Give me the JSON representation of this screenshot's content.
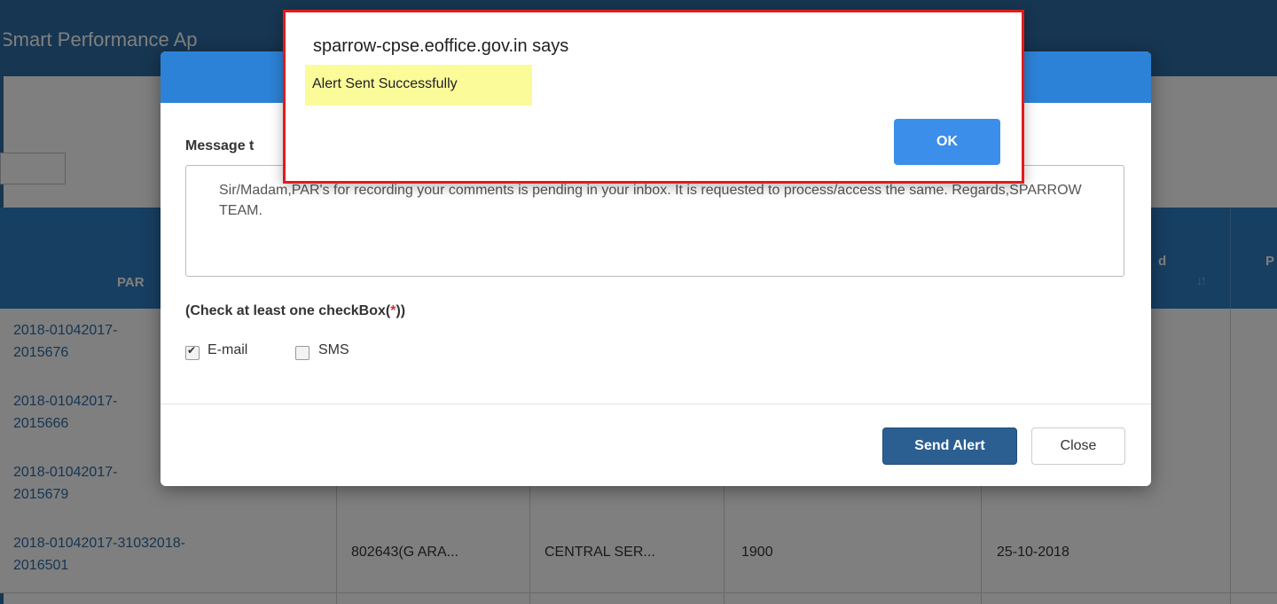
{
  "app": {
    "title": "Smart Performance Ap"
  },
  "table": {
    "headers": {
      "col1_partial": "PAR",
      "col_d_partial": "d",
      "col_p_partial": "P"
    },
    "rows": [
      {
        "par_no": "2018-01042017-\n2015676",
        "employee": "",
        "service": "",
        "batch": "",
        "date": ""
      },
      {
        "par_no": "2018-01042017-\n2015666",
        "employee": "",
        "service": "",
        "batch": "",
        "date": ""
      },
      {
        "par_no": "2018-01042017-\n2015679",
        "employee": "",
        "service": "",
        "batch": "",
        "date": ""
      },
      {
        "par_no": "2018-01042017-31032018-\n2016501",
        "employee": "802643(G ARA...",
        "service": "CENTRAL SER...",
        "batch": "1900",
        "date": "25-10-2018"
      }
    ]
  },
  "modal": {
    "message_label": "Message t",
    "message_text": "Sir/Madam,PAR's for recording your comments is pending in your inbox. It is requested to process/access the same. Regards,SPARROW TEAM.",
    "check_note_prefix": "(Check at least one checkBox(",
    "check_note_star": "*",
    "check_note_suffix": "))",
    "email_label": "E-mail",
    "email_checked": true,
    "sms_label": "SMS",
    "sms_checked": false,
    "send_label": "Send Alert",
    "close_label": "Close"
  },
  "alert": {
    "origin": "sparrow-cpse.eoffice.gov.in says",
    "message": "Alert Sent Successfully",
    "ok_label": "OK"
  },
  "colors": {
    "header_blue": "#2e6da4",
    "table_head_blue": "#2f7fc4",
    "send_button": "#2c5f91",
    "ok_button": "#3b8eea",
    "alert_border": "#e21b1b",
    "highlight": "#fbfb9a"
  }
}
